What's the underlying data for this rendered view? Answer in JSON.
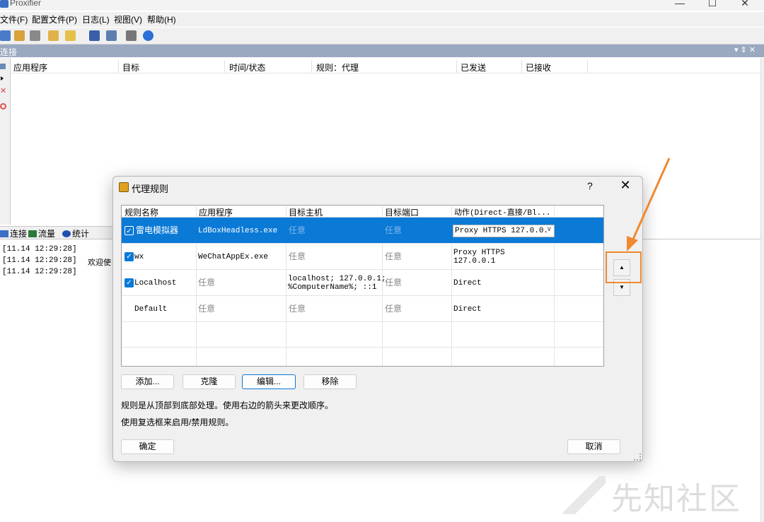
{
  "window": {
    "title": "Proxifier",
    "min_glyph": "—",
    "max_glyph": "☐",
    "close_glyph": "✕"
  },
  "menu": [
    "文件(F)",
    "配置文件(P)",
    "日志(L)",
    "视图(V)",
    "帮助(H)"
  ],
  "connections_panel": {
    "title": "连接",
    "controls": "▾ ⇕ ✕",
    "columns": [
      "应用程序",
      "目标",
      "时间/状态",
      "规则：代理",
      "已发送",
      "已接收"
    ]
  },
  "bottom_tabs": [
    "连接",
    "流量",
    "统计"
  ],
  "log": [
    {
      "time": "[11.14 12:29:28]",
      "msg": "欢迎使"
    },
    {
      "time": "[11.14 12:29:28]",
      "msg": ""
    },
    {
      "time": "[11.14 12:29:28]",
      "msg": ""
    }
  ],
  "dialog": {
    "title": "代理规则",
    "help": "?",
    "close": "✕",
    "columns": [
      "规则名称",
      "应用程序",
      "目标主机",
      "目标端口",
      "动作(Direct-直接/Bl..."
    ],
    "rules": [
      {
        "enabled": true,
        "selected": true,
        "name": "雷电模拟器",
        "app": "LdBoxHeadless.exe",
        "host": "任意",
        "port": "任意",
        "action": "Proxy HTTPS 127.0.0."
      },
      {
        "enabled": true,
        "selected": false,
        "name": "wx",
        "app": "WeChatAppEx.exe",
        "host": "任意",
        "port": "任意",
        "action_line1": "Proxy HTTPS",
        "action_line2": "127.0.0.1"
      },
      {
        "enabled": true,
        "selected": false,
        "name": "Localhost",
        "app": "任意",
        "host_line1": "localhost; 127.0.0.1;",
        "host_line2": "%ComputerName%; ::1",
        "port": "任意",
        "action": "Direct"
      },
      {
        "enabled": false,
        "selected": false,
        "name": "Default",
        "app": "任意",
        "host": "任意",
        "port": "任意",
        "action": "Direct"
      }
    ],
    "buttons": {
      "add": "添加...",
      "clone": "克隆",
      "edit": "编辑...",
      "remove": "移除",
      "ok": "确定",
      "cancel": "取消"
    },
    "hint1": "规则是从顶部到底部处理。使用右边的箭头来更改顺序。",
    "hint2": "使用复选框来启用/禁用规则。",
    "move_up": "▲",
    "move_down": "▼"
  },
  "annotation": {
    "color": "#f0892f"
  },
  "watermark": "先知社区"
}
